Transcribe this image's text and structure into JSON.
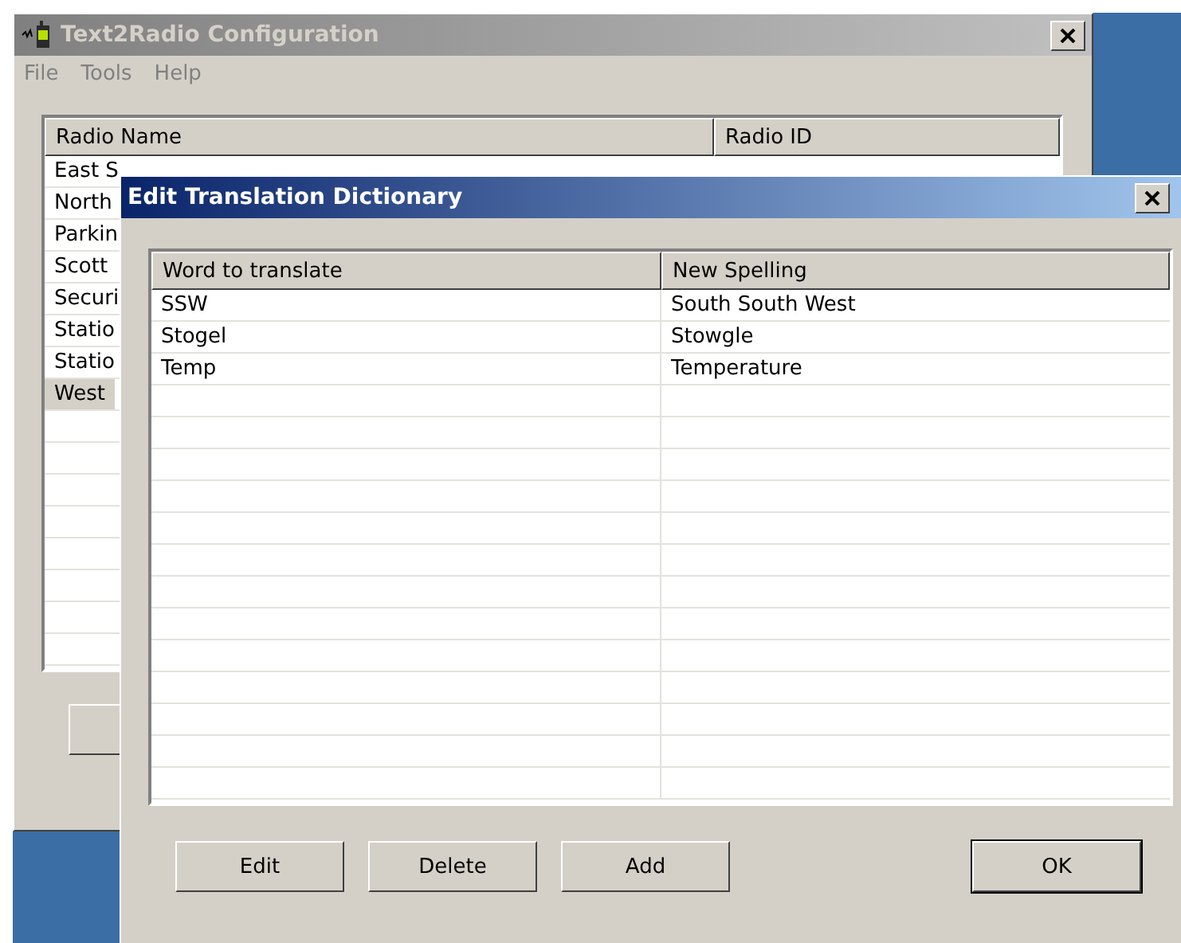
{
  "main_window": {
    "title": "Text2Radio Configuration",
    "active": false,
    "menu": [
      "File",
      "Tools",
      "Help"
    ],
    "columns": [
      "Radio Name",
      "Radio ID"
    ],
    "rows": [
      {
        "name": "East S",
        "selected": false
      },
      {
        "name": "North",
        "selected": false
      },
      {
        "name": "Parkin",
        "selected": false
      },
      {
        "name": "Scott",
        "selected": false
      },
      {
        "name": "Securi",
        "selected": false
      },
      {
        "name": "Statio",
        "selected": false
      },
      {
        "name": "Statio",
        "selected": false
      },
      {
        "name": "West",
        "selected": true
      }
    ]
  },
  "dialog": {
    "title": "Edit Translation Dictionary",
    "active": true,
    "columns": [
      "Word to translate",
      "New Spelling"
    ],
    "rows": [
      {
        "word": "SSW",
        "spelling": "South South West"
      },
      {
        "word": "Stogel",
        "spelling": "Stowgle"
      },
      {
        "word": "Temp",
        "spelling": "Temperature"
      }
    ],
    "buttons": [
      {
        "label": "Edit",
        "default": false
      },
      {
        "label": "Delete",
        "default": false
      },
      {
        "label": "Add",
        "default": false
      },
      {
        "label": "OK",
        "default": true
      }
    ]
  }
}
